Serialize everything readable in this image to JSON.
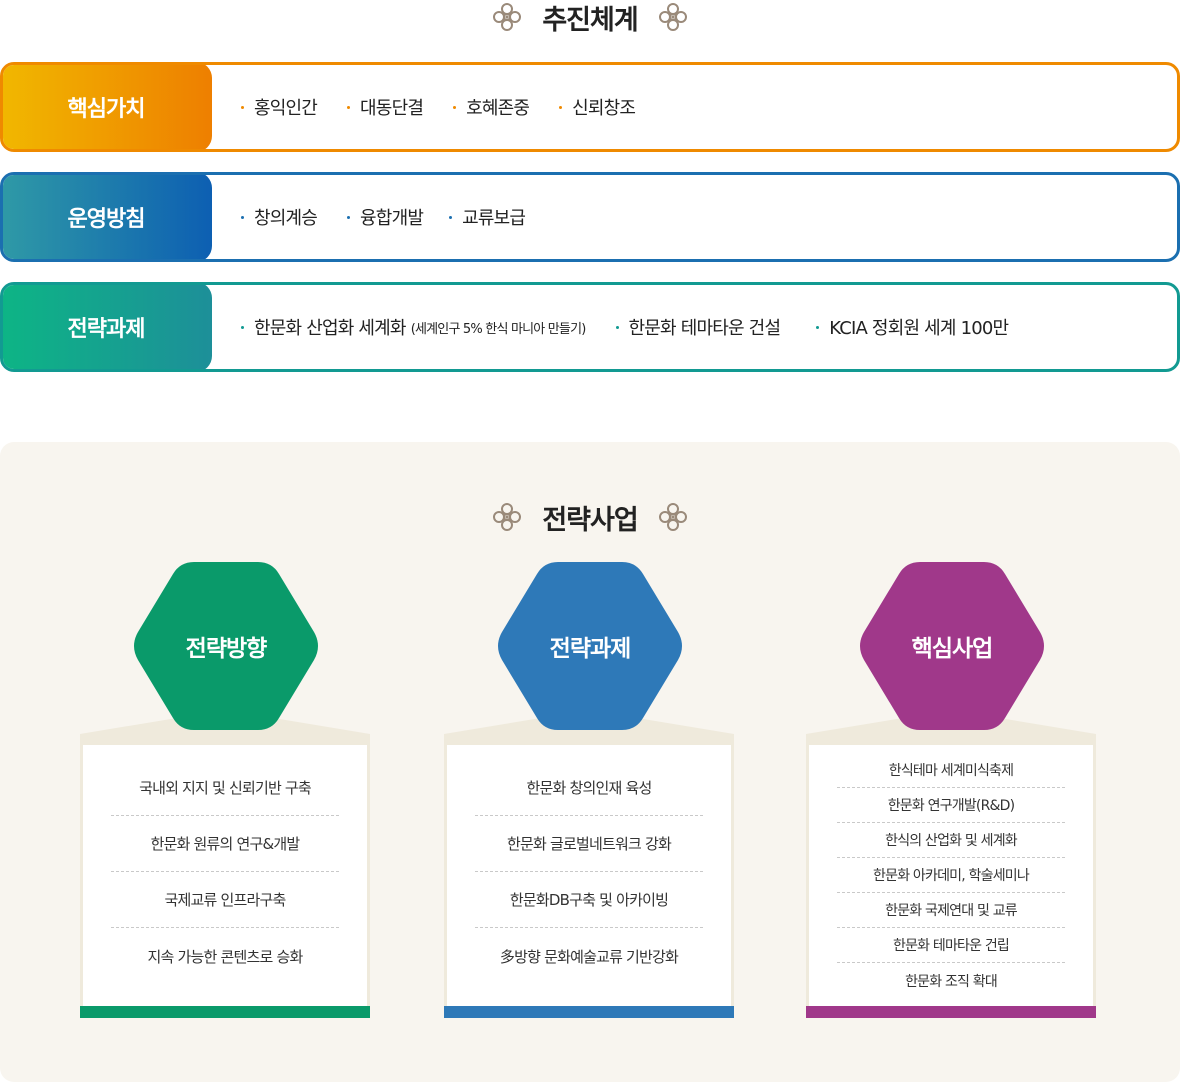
{
  "header": {
    "title": "추진체계"
  },
  "rows": [
    {
      "label": "핵심가치",
      "color": "#ef8a00",
      "gradient": [
        "#f1b800",
        "#ee7f00"
      ],
      "items": [
        {
          "text": "홍익인간"
        },
        {
          "text": "대동단결"
        },
        {
          "text": "호혜존중"
        },
        {
          "text": "신뢰창조"
        }
      ]
    },
    {
      "label": "운영방침",
      "color": "#1b6fb0",
      "gradient": [
        "#2f9aa6",
        "#0d5fb2"
      ],
      "items": [
        {
          "text": "창의계승"
        },
        {
          "text": "융합개발"
        },
        {
          "text": "교류보급"
        }
      ]
    },
    {
      "label": "전략과제",
      "color": "#129a92",
      "gradient": [
        "#0db585",
        "#1d8f99"
      ],
      "items": [
        {
          "text": "한문화 산업화 세계화",
          "sub": "(세계인구 5% 한식 마니아 만들기)"
        },
        {
          "text": "한문화 테마타운 건설"
        },
        {
          "text": "KCIA 정회원 세계 100만"
        }
      ]
    }
  ],
  "section": {
    "title": "전략사업"
  },
  "columns": [
    {
      "title": "전략방향",
      "color": "#0a9a6a",
      "items": [
        "국내외 지지 및 신뢰기반 구축",
        "한문화 원류의 연구&개발",
        "국제교류 인프라구축",
        "지속 가능한 콘텐츠로 승화"
      ]
    },
    {
      "title": "전략과제",
      "color": "#2e79b8",
      "items": [
        "한문화 창의인재 육성",
        "한문화 글로벌네트워크 강화",
        "한문화DB구축 및 아카이빙",
        "多방향 문화예술교류 기반강화"
      ]
    },
    {
      "title": "핵심사업",
      "color": "#a0388a",
      "items": [
        "한식테마 세계미식축제",
        "한문화 연구개발(R&D)",
        "한식의 산업화 및 세계화",
        "한문화 아카데미, 학술세미나",
        "한문화 국제연대 및 교류",
        "한문화 테마타운 건립",
        "한문화 조직 확대"
      ]
    }
  ],
  "icons": {
    "ornament": "knot-ornament-icon"
  }
}
